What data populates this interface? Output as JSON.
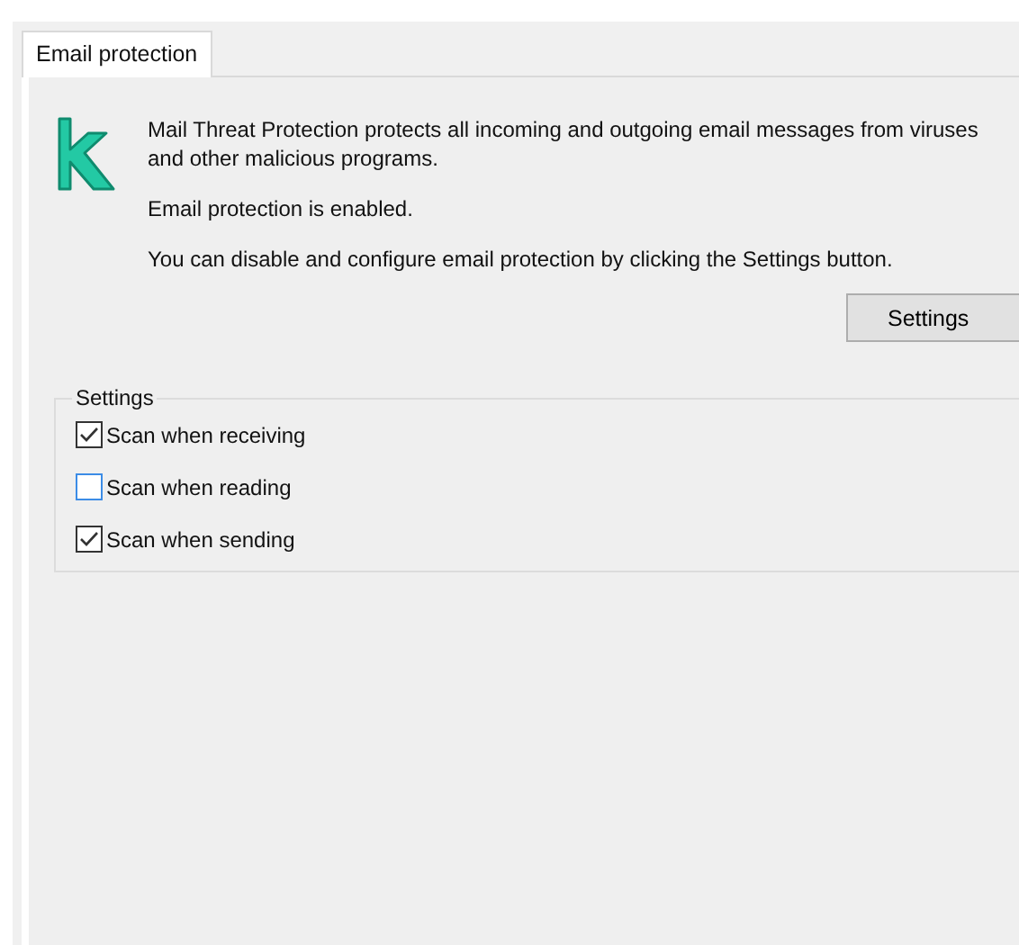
{
  "tabs": [
    {
      "label": "Email protection",
      "selected": true
    }
  ],
  "description": "Mail Threat Protection protects all incoming and outgoing email messages from viruses and other malicious programs.",
  "status": "Email protection is enabled.",
  "hint": "You can disable and configure email protection by clicking the Settings button.",
  "settings_button": "Settings",
  "settings_group": {
    "title": "Settings",
    "options": [
      {
        "label": "Scan when receiving",
        "checked": true
      },
      {
        "label": "Scan when reading",
        "checked": false
      },
      {
        "label": "Scan when sending",
        "checked": true
      }
    ]
  }
}
